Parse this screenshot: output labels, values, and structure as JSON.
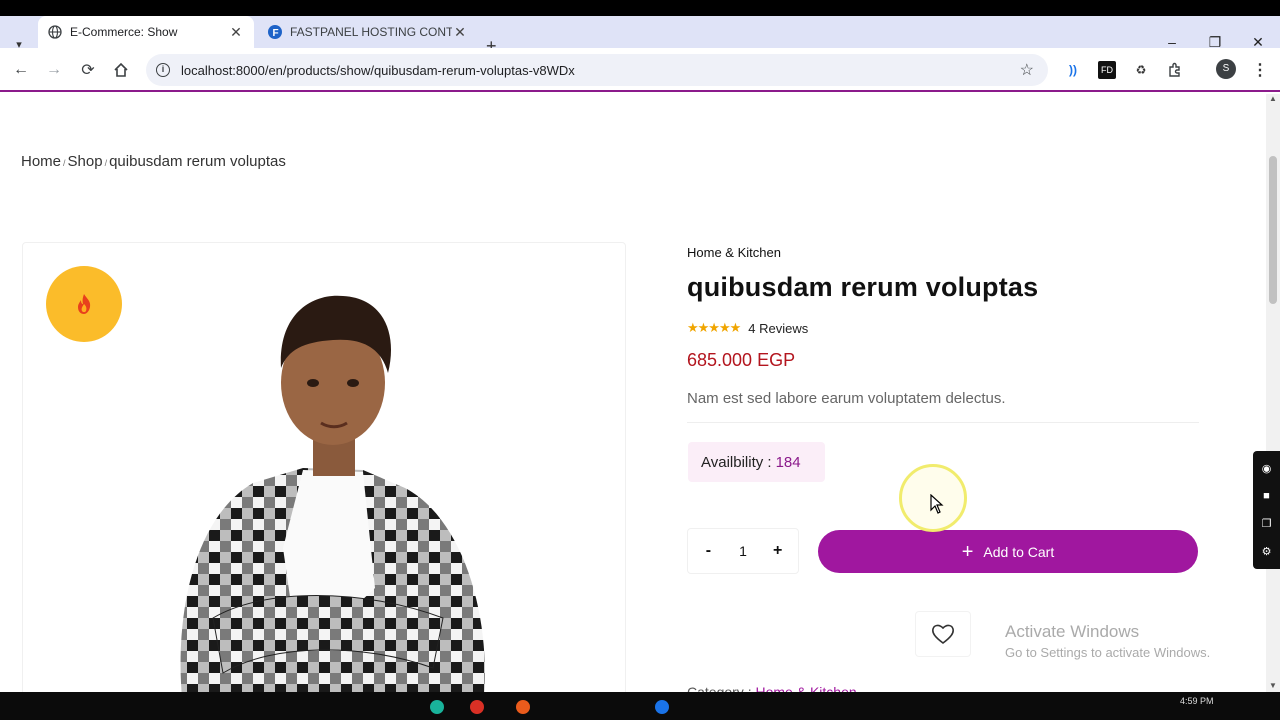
{
  "browser": {
    "tabs": [
      {
        "label": "E-Commerce: Show",
        "active": true
      },
      {
        "label": "FASTPANEL HOSTING CONTRO",
        "active": false
      }
    ],
    "url": "localhost:8000/en/products/show/quibusdam-rerum-voluptas-v8WDx",
    "profile_initial": "S"
  },
  "breadcrumb": {
    "home": "Home",
    "shop": "Shop",
    "current": "quibusdam rerum voluptas",
    "sep": "/"
  },
  "product": {
    "category": "Home & Kitchen",
    "title": "quibusdam rerum voluptas",
    "rating": 5,
    "stars": "★★★★★",
    "reviews_label": "4 Reviews",
    "price": "685.000 EGP",
    "description": "Nam est sed labore earum voluptatem delectus.",
    "availability_label": "Availbility :",
    "availability_count": "184",
    "quantity": "1",
    "minus": "-",
    "plus": "+",
    "add_to_cart": "Add to Cart",
    "meta_label": "Category :",
    "meta_value": "Home & Kitchen"
  },
  "watermark": {
    "line1": "Activate Windows",
    "line2": "Go to Settings to activate Windows."
  },
  "taskbar": {
    "clock": "4:59 PM"
  },
  "colors": {
    "brand": "#a0179f",
    "price": "#b3151e",
    "badge": "#fbbc2a",
    "star": "#f0a500"
  }
}
